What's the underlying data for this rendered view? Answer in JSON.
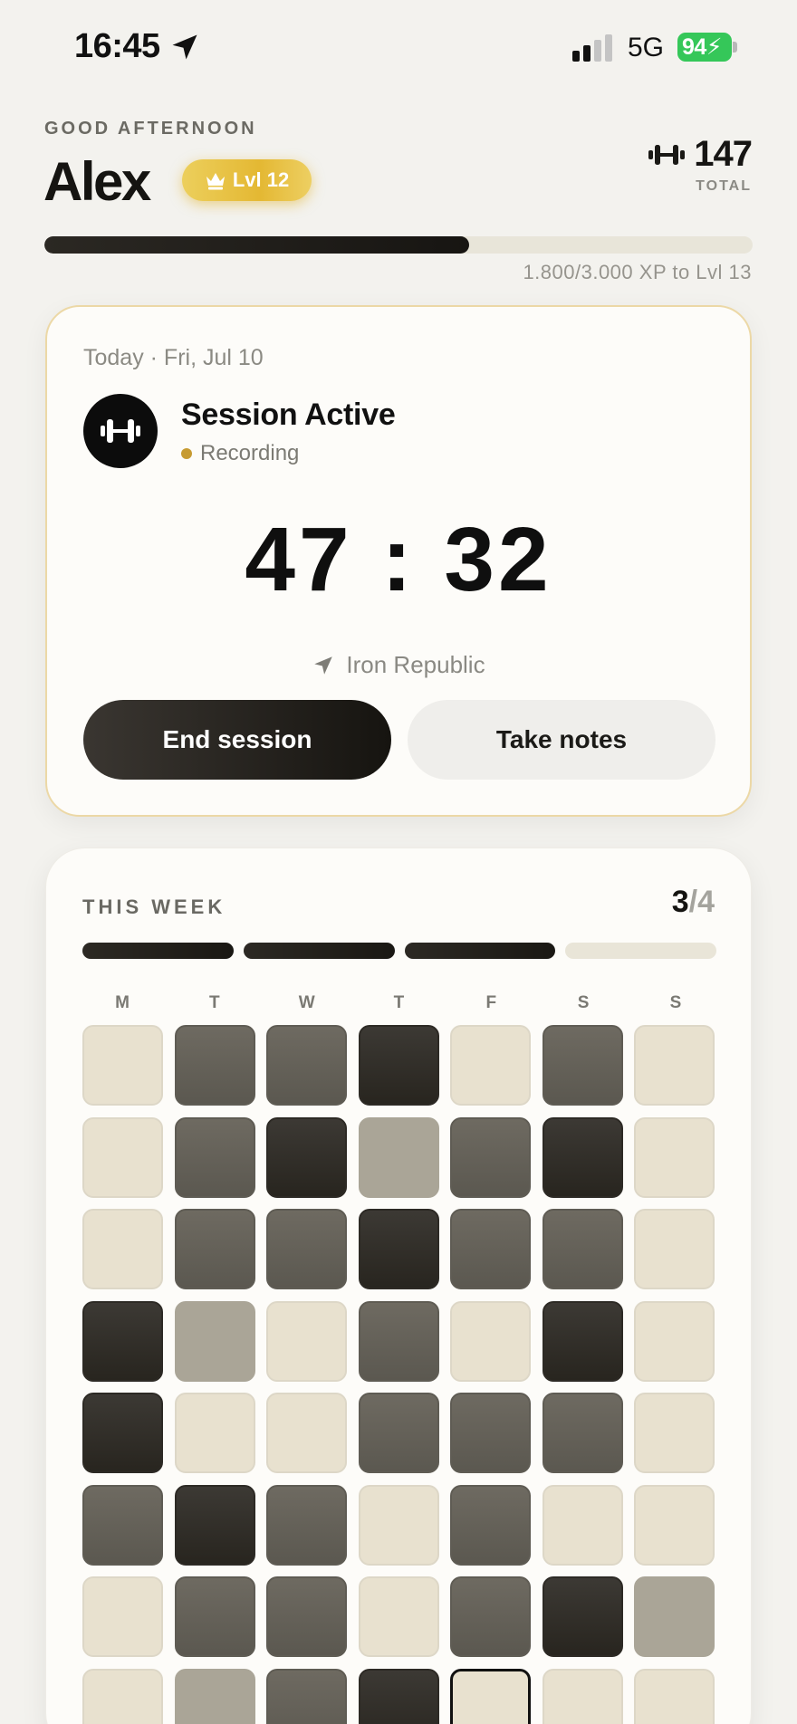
{
  "status_bar": {
    "time": "16:45",
    "network": "5G",
    "battery": "94"
  },
  "header": {
    "greeting": "GOOD AFTERNOON",
    "name": "Alex",
    "level": "Lvl 12",
    "total_value": "147",
    "total_label": "TOTAL",
    "xp_current": 1800,
    "xp_target": 3000,
    "xp_text": "1.800/3.000 XP to Lvl 13"
  },
  "session": {
    "date": "Today · Fri, Jul 10",
    "title": "Session Active",
    "status": "Recording",
    "timer": "47 : 32",
    "location": "Iron Republic",
    "end_label": "End session",
    "notes_label": "Take notes"
  },
  "week": {
    "label": "THIS WEEK",
    "done": "3",
    "separator": "/",
    "goal": "4",
    "segments": [
      true,
      true,
      true,
      false
    ],
    "days": [
      "M",
      "T",
      "W",
      "T",
      "F",
      "S",
      "S"
    ],
    "heatmap": [
      [
        0,
        2,
        2,
        3,
        0,
        2,
        0
      ],
      [
        0,
        2,
        3,
        1,
        2,
        3,
        0
      ],
      [
        0,
        2,
        2,
        3,
        2,
        2,
        0
      ],
      [
        3,
        1,
        0,
        2,
        0,
        3,
        0
      ],
      [
        3,
        0,
        0,
        2,
        2,
        2,
        0
      ],
      [
        2,
        3,
        2,
        0,
        2,
        0,
        0
      ],
      [
        0,
        2,
        2,
        0,
        2,
        3,
        1
      ],
      [
        0,
        1,
        2,
        3,
        0,
        0,
        0
      ]
    ],
    "today_cell": {
      "row": 7,
      "col": 4
    }
  },
  "colors": {
    "accent_gold": "#e4b833",
    "battery_green": "#35c759",
    "dark": "#161410"
  }
}
